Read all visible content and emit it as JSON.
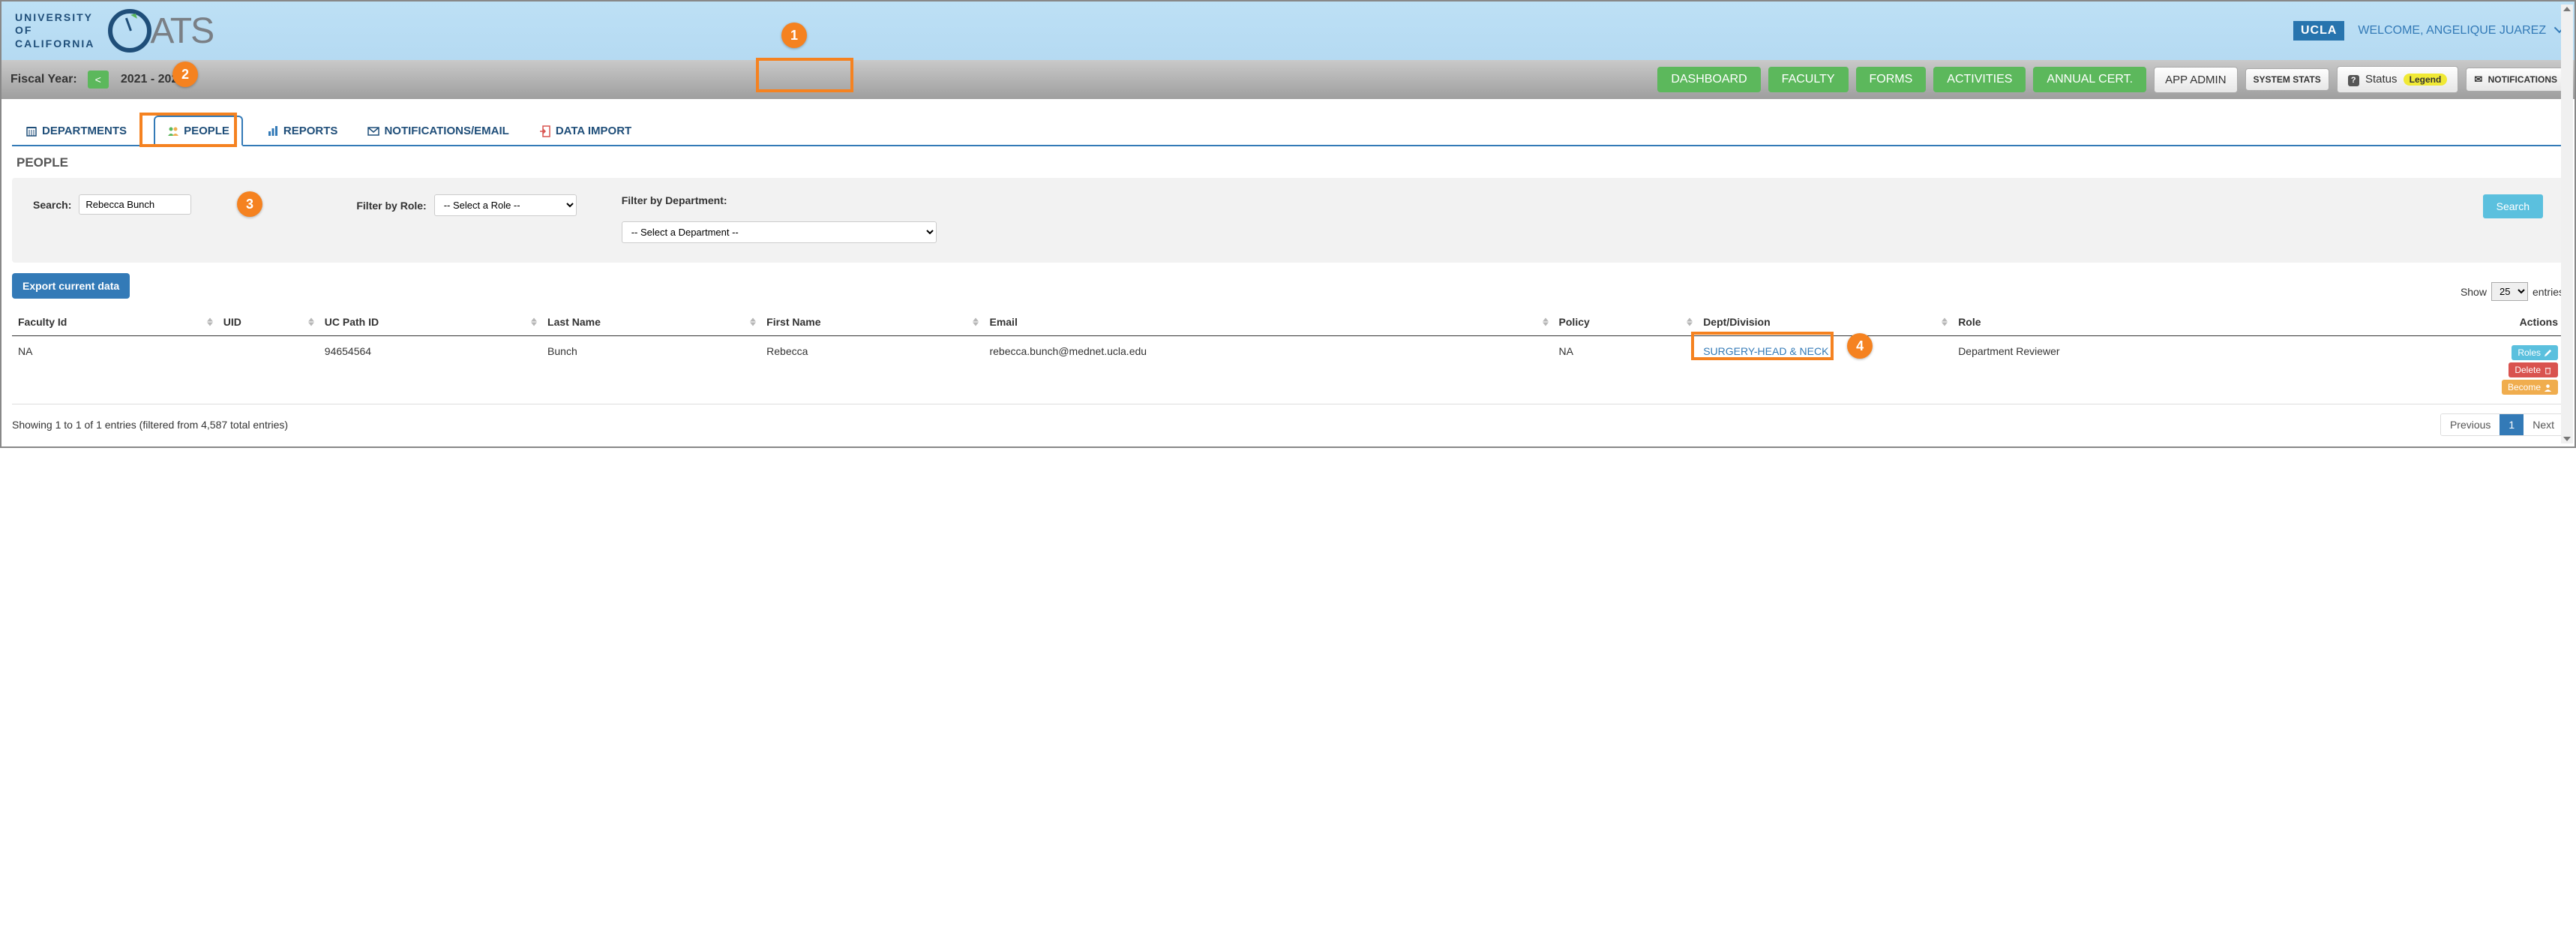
{
  "brand": {
    "uc_lines": "UNIVERSITY\nOF\nCALIFORNIA",
    "oats_suffix": "ATS"
  },
  "header": {
    "ucla_badge": "UCLA",
    "welcome": "WELCOME, ANGELIQUE JUAREZ"
  },
  "navbar": {
    "fiscal_label": "Fiscal Year:",
    "year_prev": "<",
    "year_text": "2021 - 2022",
    "buttons": {
      "dashboard": "DASHBOARD",
      "faculty": "FACULTY",
      "forms": "FORMS",
      "activities": "ACTIVITIES",
      "annual_cert": "ANNUAL CERT.",
      "app_admin": "APP ADMIN",
      "system_stats": "SYSTEM STATS",
      "status": "Status",
      "legend": "Legend",
      "notifications": "NOTIFICATIONS"
    }
  },
  "tabs": {
    "departments": "DEPARTMENTS",
    "people": "PEOPLE",
    "reports": "REPORTS",
    "notifications_email": "NOTIFICATIONS/EMAIL",
    "data_import": "DATA IMPORT"
  },
  "page_heading": "PEOPLE",
  "filters": {
    "search_label": "Search:",
    "search_value": "Rebecca Bunch",
    "role_label": "Filter by Role:",
    "role_placeholder": "-- Select a Role --",
    "dept_label": "Filter by Department:",
    "dept_placeholder": "-- Select a Department --",
    "search_button": "Search"
  },
  "export_button": "Export current data",
  "entries": {
    "show_label": "Show",
    "value": "25",
    "suffix": "entries"
  },
  "table": {
    "headers": {
      "faculty_id": "Faculty Id",
      "uid": "UID",
      "uc_path_id": "UC Path ID",
      "last_name": "Last Name",
      "first_name": "First Name",
      "email": "Email",
      "policy": "Policy",
      "dept_division": "Dept/Division",
      "role": "Role",
      "actions": "Actions"
    },
    "rows": [
      {
        "faculty_id": "NA",
        "uid": "",
        "uc_path_id": "94654564",
        "last_name": "Bunch",
        "first_name": "Rebecca",
        "email": "rebecca.bunch@mednet.ucla.edu",
        "policy": "NA",
        "dept_division": "SURGERY-HEAD & NECK",
        "role": "Department Reviewer"
      }
    ],
    "action_labels": {
      "roles": "Roles",
      "delete": "Delete",
      "become": "Become"
    }
  },
  "footer": {
    "info": "Showing 1 to 1 of 1 entries (filtered from 4,587 total entries)",
    "previous": "Previous",
    "page": "1",
    "next": "Next"
  },
  "callouts": {
    "c1": "1",
    "c2": "2",
    "c3": "3",
    "c4": "4"
  }
}
